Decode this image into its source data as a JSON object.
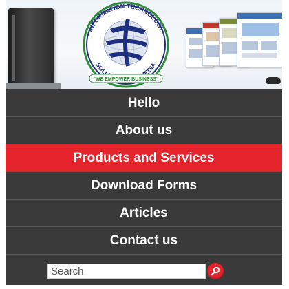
{
  "banner": {
    "logo_ring_text_top": "INFORMATION TECHNOLOGY",
    "logo_ring_text_bottom": "SOLUTIONS AND MEDIA",
    "logo_tagline": "\"WE EMPOWER BUSINESS\""
  },
  "nav": {
    "items": [
      {
        "label": "Hello",
        "active": false
      },
      {
        "label": "About us",
        "active": false
      },
      {
        "label": "Products and Services",
        "active": true
      },
      {
        "label": "Download Forms",
        "active": false
      },
      {
        "label": "Articles",
        "active": false
      },
      {
        "label": "Contact us",
        "active": false
      }
    ]
  },
  "search": {
    "placeholder": "Search",
    "icon": "search-icon"
  },
  "colors": {
    "nav_background": "#3a3a3a",
    "active_item": "#e5242b",
    "logo_navy": "#1f2f80",
    "logo_green": "#2e8b3a"
  }
}
